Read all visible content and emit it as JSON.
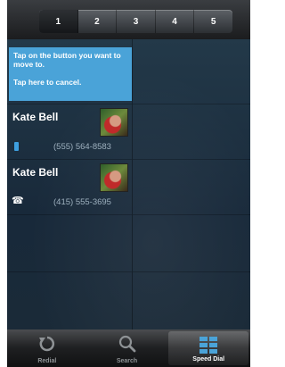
{
  "pages": [
    "1",
    "2",
    "3",
    "4",
    "5"
  ],
  "instructions": {
    "line1": "Tap on the button you want to move to.",
    "line2": "Tap here to cancel."
  },
  "contacts": [
    {
      "name": "Kate Bell",
      "phone": "(555) 564-8583",
      "type": "mobile-icon"
    },
    {
      "name": "Kate Bell",
      "phone": "(415) 555-3695",
      "type": "phone-icon"
    }
  ],
  "tabs": [
    {
      "label": "Redial",
      "icon": "redial-icon"
    },
    {
      "label": "Search",
      "icon": "search-icon"
    },
    {
      "label": "Speed Dial",
      "icon": "grid-icon"
    }
  ],
  "colors": {
    "accent": "#4aa3d8",
    "background": "#1d2f3e"
  }
}
